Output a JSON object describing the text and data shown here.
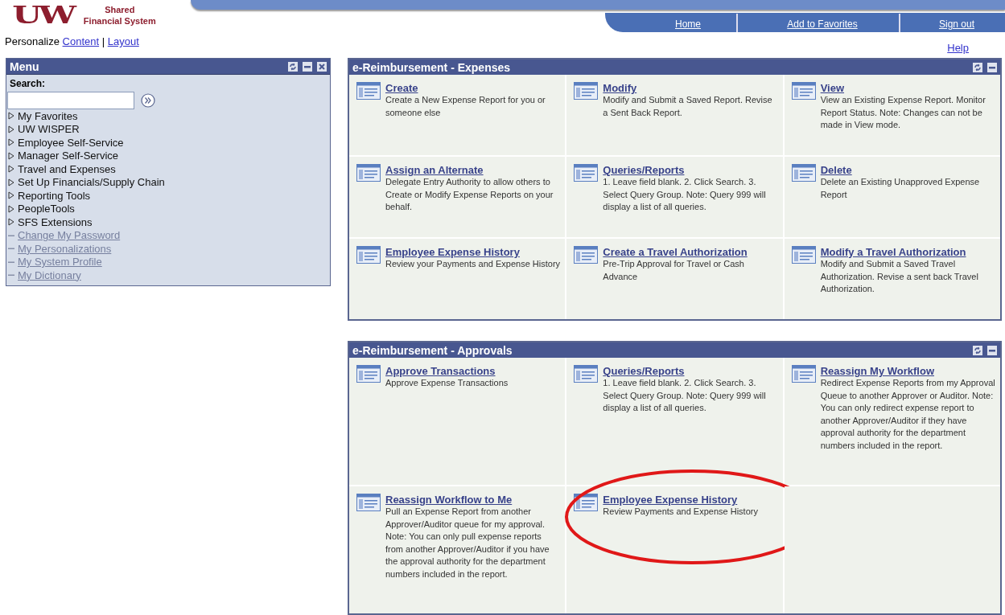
{
  "logo": {
    "mark": "UW",
    "name_lines": [
      "Shared",
      "Financial System"
    ]
  },
  "nav": [
    {
      "label": "Home"
    },
    {
      "label": "Add to Favorites"
    },
    {
      "label": "Sign out"
    }
  ],
  "personalize": {
    "label": "Personalize",
    "links": [
      "Content",
      "Layout"
    ],
    "separator": "|"
  },
  "help": "Help",
  "menu": {
    "title": "Menu",
    "search_label": "Search:",
    "items": [
      {
        "label": "My Favorites",
        "kind": "folder"
      },
      {
        "label": "UW WISPER",
        "kind": "folder"
      },
      {
        "label": "Employee Self-Service",
        "kind": "folder"
      },
      {
        "label": "Manager Self-Service",
        "kind": "folder"
      },
      {
        "label": "Travel and Expenses",
        "kind": "folder"
      },
      {
        "label": "Set Up Financials/Supply Chain",
        "kind": "folder"
      },
      {
        "label": "Reporting Tools",
        "kind": "folder"
      },
      {
        "label": "PeopleTools",
        "kind": "folder"
      },
      {
        "label": "SFS Extensions",
        "kind": "folder"
      },
      {
        "label": "Change My Password",
        "kind": "link"
      },
      {
        "label": "My Personalizations",
        "kind": "link"
      },
      {
        "label": "My System Profile",
        "kind": "link"
      },
      {
        "label": "My Dictionary",
        "kind": "link"
      }
    ]
  },
  "panels": [
    {
      "title": "e-Reimbursement - Expenses",
      "tiles": [
        {
          "title": "Create",
          "description": "Create a New Expense Report for you or someone else",
          "circled": false
        },
        {
          "title": "Modify",
          "description": "Modify and Submit a Saved Report. Revise a Sent Back Report.",
          "circled": false
        },
        {
          "title": "View",
          "description": "View an Existing Expense Report. Monitor Report Status. Note: Changes can not be made in View mode.",
          "circled": false
        },
        {
          "title": "Assign an Alternate",
          "description": "Delegate Entry Authority to allow others to Create or Modify Expense Reports on your behalf.",
          "circled": false
        },
        {
          "title": "Queries/Reports",
          "description": "1. Leave field blank. 2. Click Search. 3. Select Query Group. Note: Query 999 will display a list of all queries.",
          "circled": false
        },
        {
          "title": "Delete",
          "description": "Delete an Existing Unapproved Expense Report",
          "circled": false
        },
        {
          "title": "Employee Expense History",
          "description": "Review your Payments and Expense History",
          "circled": false
        },
        {
          "title": "Create a Travel Authorization",
          "description": "Pre-Trip Approval for Travel or Cash Advance",
          "circled": false
        },
        {
          "title": "Modify a Travel Authorization",
          "description": "Modify and Submit a Saved Travel Authorization. Revise a sent back Travel Authorization.",
          "circled": false
        }
      ]
    },
    {
      "title": "e-Reimbursement - Approvals",
      "tiles": [
        {
          "title": "Approve Transactions",
          "description": "Approve Expense Transactions",
          "circled": false
        },
        {
          "title": "Queries/Reports",
          "description": "1. Leave field blank. 2. Click Search. 3. Select Query Group. Note: Query 999 will display a list of all queries.",
          "circled": false
        },
        {
          "title": "Reassign My Workflow",
          "description": "Redirect Expense Reports from my Approval Queue to another Approver or Auditor. Note: You can only redirect expense report to another Approver/Auditor if they have approval authority for the department numbers included in the report.",
          "circled": false
        },
        {
          "title": "Reassign Workflow to Me",
          "description": "Pull an Expense Report from another Approver/Auditor queue for my approval. Note: You can only pull expense reports from another Approver/Auditor if you have the approval authority for the department numbers included in the report.",
          "circled": false
        },
        {
          "title": "Employee Expense History",
          "description": "Review Payments and Expense History",
          "circled": true
        }
      ]
    }
  ]
}
